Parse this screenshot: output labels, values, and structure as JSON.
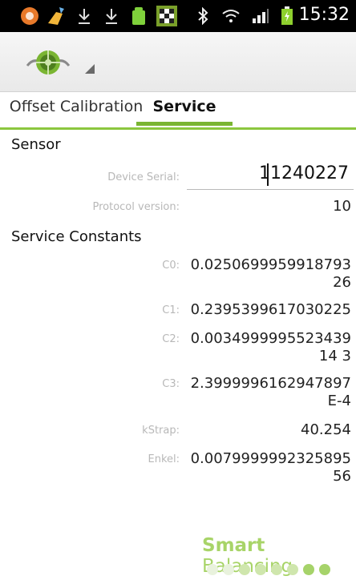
{
  "statusbar": {
    "time": "15:32",
    "icons": [
      "notification-badge-icon",
      "broom-icon",
      "download-icon",
      "download-icon",
      "android-icon",
      "checkered-flag-icon",
      "bluetooth-icon",
      "wifi-icon",
      "signal-icon",
      "battery-icon"
    ]
  },
  "actionbar": {
    "logo": "app-logo-icon"
  },
  "tabs": [
    {
      "label": "Offset Calibration"
    },
    {
      "label": "Service"
    }
  ],
  "sensor": {
    "header": "Sensor",
    "device_serial_label": "Device Serial:",
    "device_serial_value": "11240227",
    "protocol_label": "Protocol version:",
    "protocol_value": "10"
  },
  "constants": {
    "header": "Service Constants",
    "items": [
      {
        "label": "C0:",
        "value": "0.025069995991879326"
      },
      {
        "label": "C1:",
        "value": "0.2395399617030225"
      },
      {
        "label": "C2:",
        "value": "0.003499999552343914 3"
      },
      {
        "label": "C3:",
        "value": "2.3999996162947897E-4"
      },
      {
        "label": "kStrap:",
        "value": "40.254"
      },
      {
        "label": "Enkel:",
        "value": "0.007999999232589556"
      }
    ]
  },
  "brand": {
    "part1": "Smart",
    "part2": " Balancing"
  },
  "colors": {
    "accent": "#8cc63f",
    "brand": "#a8d468"
  }
}
